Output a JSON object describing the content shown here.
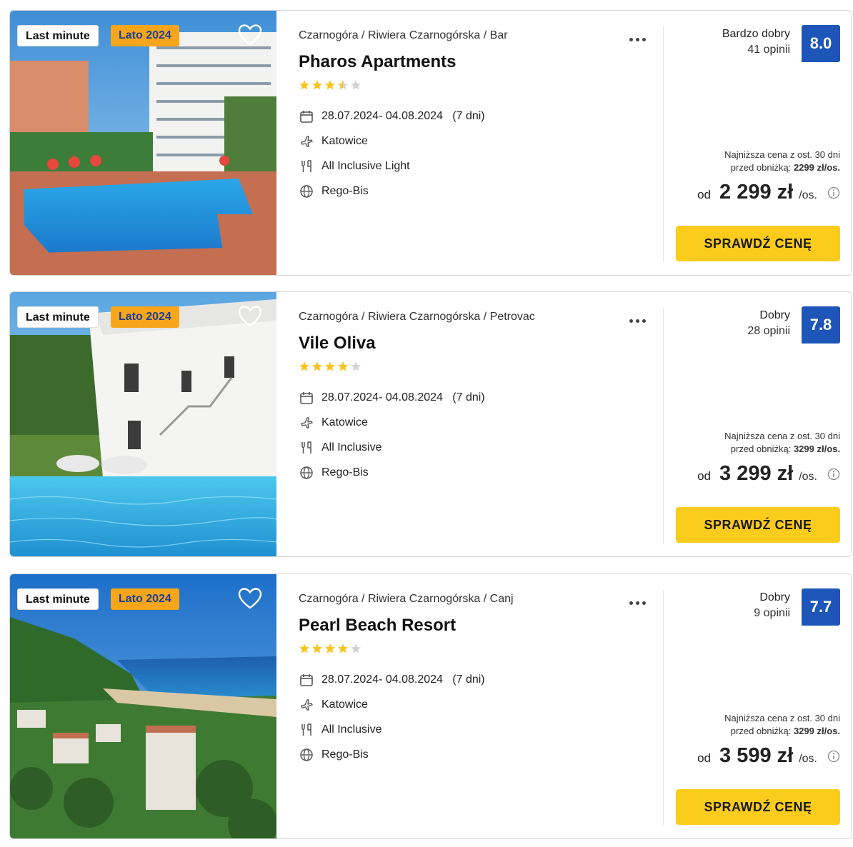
{
  "offers": [
    {
      "badges": {
        "last_minute": "Last minute",
        "season": "Lato 2024"
      },
      "breadcrumb": "Czarnogóra / Riwiera Czarnogórska / Bar",
      "name": "Pharos Apartments",
      "stars": 3.5,
      "dates": "28.07.2024- 04.08.2024   (7 dni)",
      "departure": "Katowice",
      "board": "All Inclusive Light",
      "operator": "Rego-Bis",
      "rating_label": "Bardzo dobry",
      "rating_count": "41 opinii",
      "score": "8.0",
      "lowest_line1": "Najniższa cena z ost. 30 dni",
      "lowest_line2_prefix": "przed obniżką: ",
      "lowest_line2_value": "2299 zł/os.",
      "price_from": "od",
      "price": "2 299 zł",
      "price_unit": "/os.",
      "cta": "SPRAWDŹ CENĘ"
    },
    {
      "badges": {
        "last_minute": "Last minute",
        "season": "Lato 2024"
      },
      "breadcrumb": "Czarnogóra / Riwiera Czarnogórska / Petrovac",
      "name": "Vile Oliva",
      "stars": 4,
      "dates": "28.07.2024- 04.08.2024   (7 dni)",
      "departure": "Katowice",
      "board": "All Inclusive",
      "operator": "Rego-Bis",
      "rating_label": "Dobry",
      "rating_count": "28 opinii",
      "score": "7.8",
      "lowest_line1": "Najniższa cena z ost. 30 dni",
      "lowest_line2_prefix": "przed obniżką: ",
      "lowest_line2_value": "3299 zł/os.",
      "price_from": "od",
      "price": "3 299 zł",
      "price_unit": "/os.",
      "cta": "SPRAWDŹ CENĘ"
    },
    {
      "badges": {
        "last_minute": "Last minute",
        "season": "Lato 2024"
      },
      "breadcrumb": "Czarnogóra / Riwiera Czarnogórska / Canj",
      "name": "Pearl Beach Resort",
      "stars": 4,
      "dates": "28.07.2024- 04.08.2024   (7 dni)",
      "departure": "Katowice",
      "board": "All Inclusive",
      "operator": "Rego-Bis",
      "rating_label": "Dobry",
      "rating_count": "9 opinii",
      "score": "7.7",
      "lowest_line1": "Najniższa cena z ost. 30 dni",
      "lowest_line2_prefix": "przed obniżką: ",
      "lowest_line2_value": "3299 zł/os.",
      "price_from": "od",
      "price": "3 599 zł",
      "price_unit": "/os.",
      "cta": "SPRAWDŹ CENĘ"
    }
  ],
  "colors": {
    "accent": "#fccc1d",
    "score_bg": "#1d56b8",
    "season_badge": "#f7a61c",
    "star": "#f7c41f"
  },
  "icons": [
    "heart-icon",
    "more-icon",
    "calendar-icon",
    "plane-icon",
    "cutlery-icon",
    "globe-icon",
    "info-icon",
    "star-icon"
  ]
}
